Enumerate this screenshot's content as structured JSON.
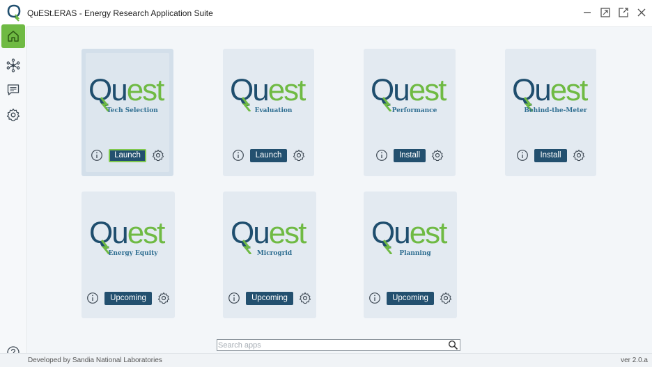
{
  "window": {
    "title": "QuESt.ERAS - Energy Research Application Suite"
  },
  "sidebar": {
    "items": [
      {
        "icon": "home-icon",
        "active": true
      },
      {
        "icon": "network-icon",
        "active": false
      },
      {
        "icon": "chat-icon",
        "active": false
      },
      {
        "icon": "gear-icon",
        "active": false
      }
    ]
  },
  "apps": [
    {
      "brand": "Quest",
      "subtitle": "Tech Selection",
      "action": "Launch"
    },
    {
      "brand": "Quest",
      "subtitle": "Evaluation",
      "action": "Launch"
    },
    {
      "brand": "Quest",
      "subtitle": "Performance",
      "action": "Install"
    },
    {
      "brand": "Quest",
      "subtitle": "Behind-the-Meter",
      "action": "Install"
    },
    {
      "brand": "Quest",
      "subtitle": "Energy Equity",
      "action": "Upcoming"
    },
    {
      "brand": "Quest",
      "subtitle": "Microgrid",
      "action": "Upcoming"
    },
    {
      "brand": "Quest",
      "subtitle": "Planning",
      "action": "Upcoming"
    }
  ],
  "search": {
    "placeholder": "Search apps",
    "value": ""
  },
  "footer": {
    "developer": "Developed by Sandia National Laboratories",
    "version": "ver 2.0.a"
  },
  "colors": {
    "accent_green": "#6fba43",
    "brand_navy": "#23506f",
    "card_bg": "#e3eaf1"
  }
}
